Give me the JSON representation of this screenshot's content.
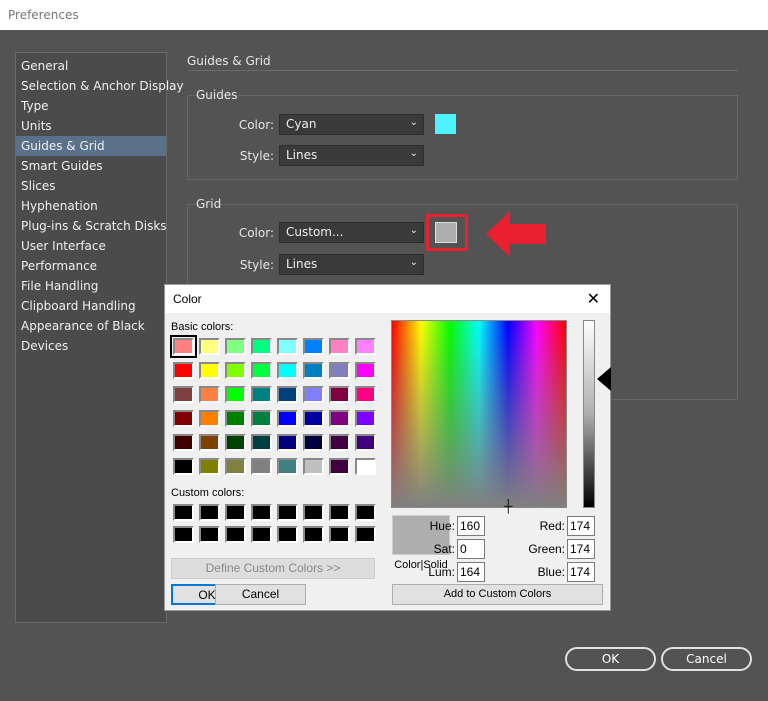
{
  "window": {
    "title": "Preferences"
  },
  "sidebar": {
    "items": [
      {
        "label": "General"
      },
      {
        "label": "Selection & Anchor Display"
      },
      {
        "label": "Type"
      },
      {
        "label": "Units"
      },
      {
        "label": "Guides & Grid",
        "selected": true
      },
      {
        "label": "Smart Guides"
      },
      {
        "label": "Slices"
      },
      {
        "label": "Hyphenation"
      },
      {
        "label": "Plug-ins & Scratch Disks"
      },
      {
        "label": "User Interface"
      },
      {
        "label": "Performance"
      },
      {
        "label": "File Handling"
      },
      {
        "label": "Clipboard Handling"
      },
      {
        "label": "Appearance of Black"
      },
      {
        "label": "Devices"
      }
    ]
  },
  "main": {
    "title": "Guides & Grid",
    "guides": {
      "label": "Guides",
      "color_label": "Color:",
      "color_value": "Cyan",
      "color_swatch": "#4ef3ff",
      "style_label": "Style:",
      "style_value": "Lines"
    },
    "grid": {
      "label": "Grid",
      "color_label": "Color:",
      "color_value": "Custom...",
      "color_swatch": "#aeaeae",
      "style_label": "Style:",
      "style_value": "Lines",
      "highlight_color": "#e8202f"
    }
  },
  "color_dialog": {
    "title": "Color",
    "basic_colors_label": "Basic colors:",
    "basic_colors": [
      "#ff8080",
      "#ffff80",
      "#80ff80",
      "#00ff80",
      "#80ffff",
      "#0080ff",
      "#ff80c0",
      "#ff80ff",
      "#ff0000",
      "#ffff00",
      "#80ff00",
      "#00ff40",
      "#00ffff",
      "#0080c0",
      "#8080c0",
      "#ff00ff",
      "#804040",
      "#ff8040",
      "#00ff00",
      "#008080",
      "#004080",
      "#8080ff",
      "#800040",
      "#ff0080",
      "#800000",
      "#ff8000",
      "#008000",
      "#008040",
      "#0000ff",
      "#0000a0",
      "#800080",
      "#8000ff",
      "#400000",
      "#804000",
      "#004000",
      "#004040",
      "#000080",
      "#000040",
      "#400040",
      "#400080",
      "#000000",
      "#808000",
      "#808040",
      "#808080",
      "#408080",
      "#c0c0c0",
      "#400040",
      "#ffffff"
    ],
    "custom_colors_label": "Custom colors:",
    "define_custom_label": "Define Custom Colors >>",
    "ok_label": "OK",
    "cancel_label": "Cancel",
    "color_solid_label": "Color|Solid",
    "preview_color": "#aeaeae",
    "fields": {
      "hue_label": "Hue:",
      "hue": "160",
      "sat_label": "Sat:",
      "sat": "0",
      "lum_label": "Lum:",
      "lum": "164",
      "red_label": "Red:",
      "red": "174",
      "green_label": "Green:",
      "green": "174",
      "blue_label": "Blue:",
      "blue": "174"
    },
    "add_custom_label": "Add to Custom Colors"
  },
  "footer": {
    "ok_label": "OK",
    "cancel_label": "Cancel"
  }
}
